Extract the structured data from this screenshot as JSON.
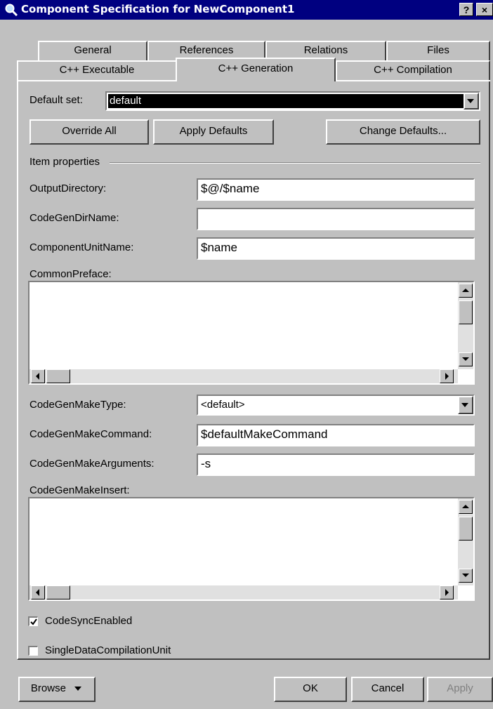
{
  "window": {
    "title": "Component Specification for NewComponent1",
    "help_label": "?",
    "close_label": "×"
  },
  "tabs_row1": [
    "General",
    "References",
    "Relations",
    "Files"
  ],
  "tabs_row2": [
    "C++ Executable",
    "C++ Generation",
    "C++ Compilation"
  ],
  "default_set": {
    "label": "Default set:",
    "value": "default"
  },
  "buttons": {
    "override_all": "Override All",
    "apply_defaults": "Apply Defaults",
    "change_defaults": "Change Defaults..."
  },
  "item_properties": "Item properties",
  "fields": {
    "output_directory": {
      "label": "OutputDirectory:",
      "value": "$@/$name"
    },
    "codegen_dir_name": {
      "label": "CodeGenDirName:",
      "value": ""
    },
    "component_unit_name": {
      "label": "ComponentUnitName:",
      "value": "$name"
    },
    "common_preface": {
      "label": "CommonPreface:",
      "value": ""
    },
    "codegen_make_type": {
      "label": "CodeGenMakeType:",
      "value": "<default>"
    },
    "codegen_make_command": {
      "label": "CodeGenMakeCommand:",
      "value": "$defaultMakeCommand"
    },
    "codegen_make_arguments": {
      "label": "CodeGenMakeArguments:",
      "value": "-s"
    },
    "codegen_make_insert": {
      "label": "CodeGenMakeInsert:",
      "value": ""
    }
  },
  "checkboxes": {
    "codesync_enabled": {
      "label": "CodeSyncEnabled",
      "checked": true
    },
    "single_data_compilation_unit": {
      "label": "SingleDataCompilationUnit",
      "checked": false
    }
  },
  "footer": {
    "browse": "Browse",
    "ok": "OK",
    "cancel": "Cancel",
    "apply": "Apply"
  },
  "colors": {
    "titlebar": "#000080",
    "face": "#c0c0c0",
    "highlight": "#000080"
  }
}
